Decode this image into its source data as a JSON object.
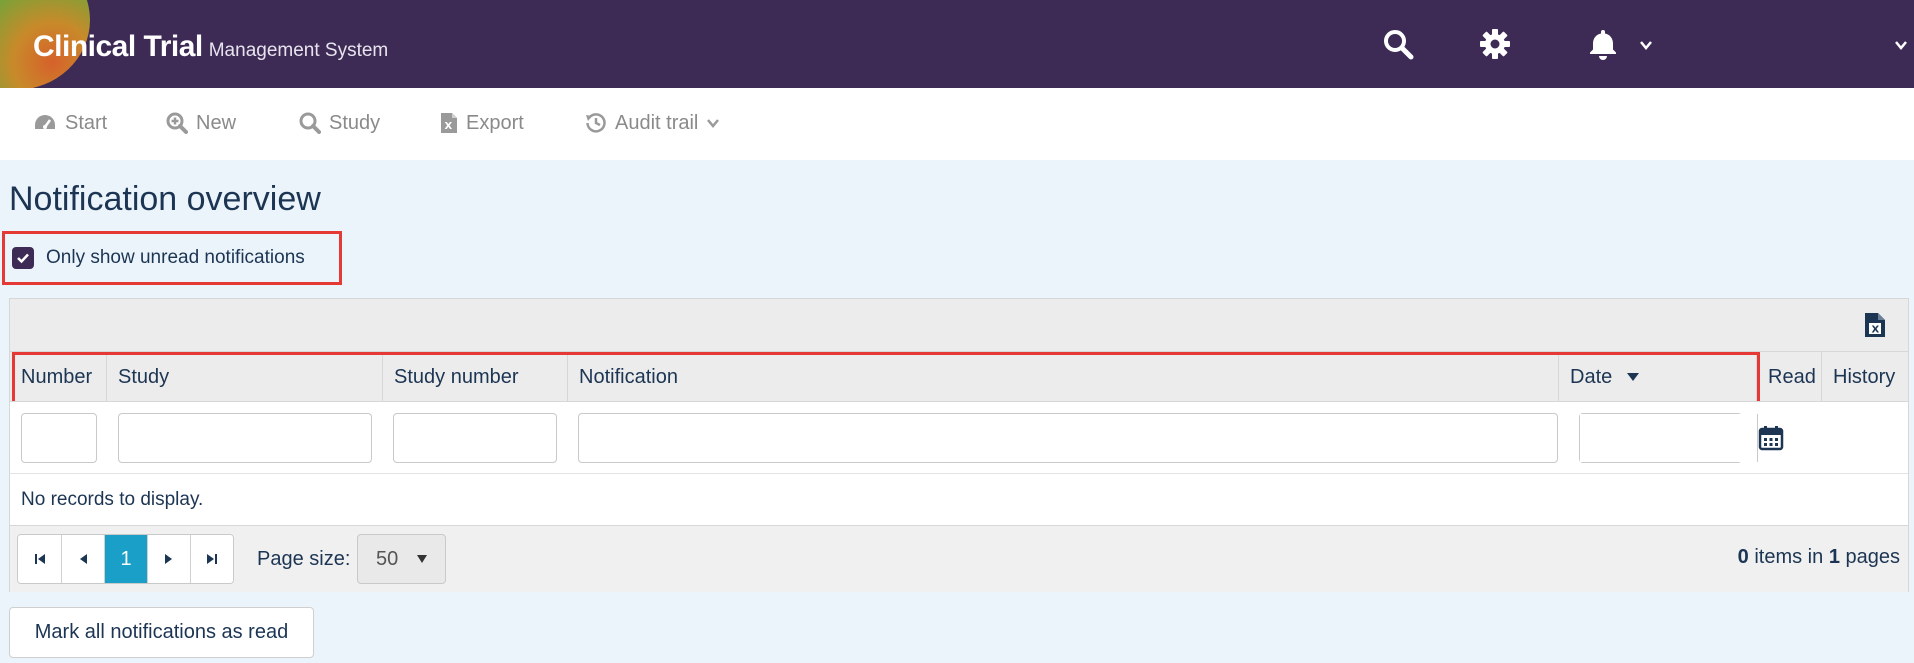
{
  "header": {
    "logo_main": "Clinical Trial",
    "logo_sub": "Management System"
  },
  "nav": {
    "items": [
      {
        "label": "Start",
        "icon": "dashboard-icon"
      },
      {
        "label": "New",
        "icon": "zoom-plus-icon"
      },
      {
        "label": "Study",
        "icon": "search-icon"
      },
      {
        "label": "Export",
        "icon": "excel-file-icon"
      },
      {
        "label": "Audit trail",
        "icon": "history-icon"
      }
    ]
  },
  "page": {
    "title": "Notification overview",
    "unread_checkbox": {
      "label": "Only show unread notifications",
      "checked": true
    }
  },
  "grid": {
    "columns": [
      "Number",
      "Study",
      "Study number",
      "Notification",
      "Date",
      "Read",
      "History"
    ],
    "sort_column": "Date",
    "sort_direction": "desc",
    "empty_text": "No records to display.",
    "pager": {
      "current_page": "1",
      "page_size_label": "Page size:",
      "page_size": "50",
      "items_count": "0",
      "items_text": " items in ",
      "pages_count": "1",
      "pages_text": " pages"
    }
  },
  "actions": {
    "mark_all_read": "Mark all notifications as read"
  },
  "colors": {
    "header_bg": "#3d2b56",
    "accent": "#1aa0c8",
    "highlight": "#e53935",
    "page_bg": "#ecf4fb"
  }
}
